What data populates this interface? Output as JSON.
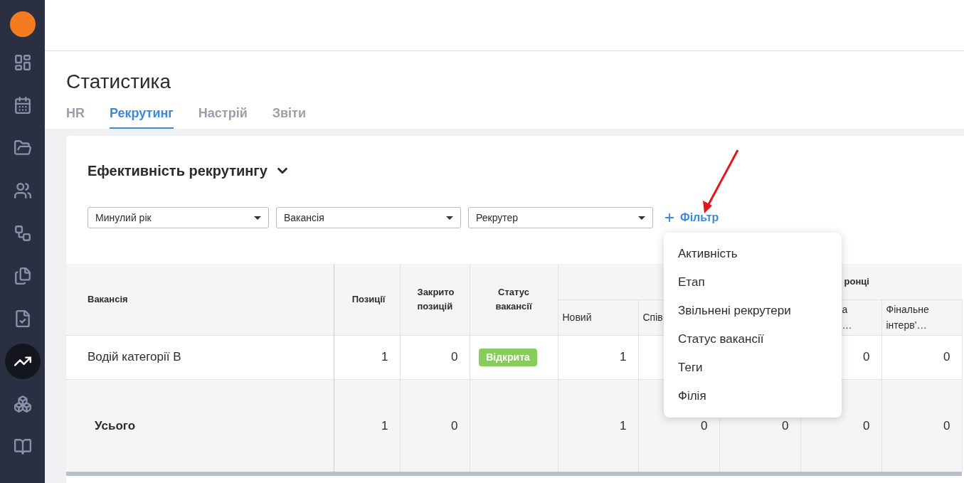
{
  "sidebar": {
    "items": [
      {
        "selected": false
      },
      {
        "selected": false
      },
      {
        "selected": false
      },
      {
        "selected": false
      },
      {
        "selected": false
      },
      {
        "selected": false
      },
      {
        "selected": false
      },
      {
        "selected": true
      },
      {
        "selected": false
      },
      {
        "selected": false
      }
    ]
  },
  "page": {
    "title": "Статистика"
  },
  "tabs": [
    {
      "label": "HR",
      "selected": false
    },
    {
      "label": "Рекрутинг",
      "selected": true
    },
    {
      "label": "Настрій",
      "selected": false
    },
    {
      "label": "Звіти",
      "selected": false
    }
  ],
  "section": {
    "title": "Ефективність рекрутингу"
  },
  "filters": [
    {
      "value": "Минулий рік"
    },
    {
      "value": "Вакансія"
    },
    {
      "value": "Рекрутер"
    }
  ],
  "add_filter": {
    "label": "Фільтр"
  },
  "filter_menu": {
    "items": [
      "Активність",
      "Етап",
      "Звільнені рекрутери",
      "Статус вакансії",
      "Теги",
      "Філія"
    ]
  },
  "table": {
    "group_header": "ронці",
    "columns": [
      {
        "label": "Вакансія"
      },
      {
        "label": "Позиції"
      },
      {
        "label": "Закрито позицій"
      },
      {
        "label": "Статус вакансії"
      },
      {
        "label": "Новий"
      },
      {
        "label": "Спів"
      },
      {},
      {
        "label": "а\n…"
      },
      {
        "label": "Фінальне інтерв’…"
      }
    ],
    "rows": [
      {
        "kind": "item",
        "cells": [
          "Водій категорії В",
          "1",
          "0",
          null,
          "1",
          null,
          null,
          "0",
          "0"
        ],
        "status": {
          "label": "Відкрита",
          "color": "#88cc5a"
        }
      },
      {
        "kind": "total",
        "cells": [
          "Усього",
          "1",
          "0",
          null,
          "1",
          "0",
          "0",
          "0",
          "0"
        ]
      }
    ]
  }
}
